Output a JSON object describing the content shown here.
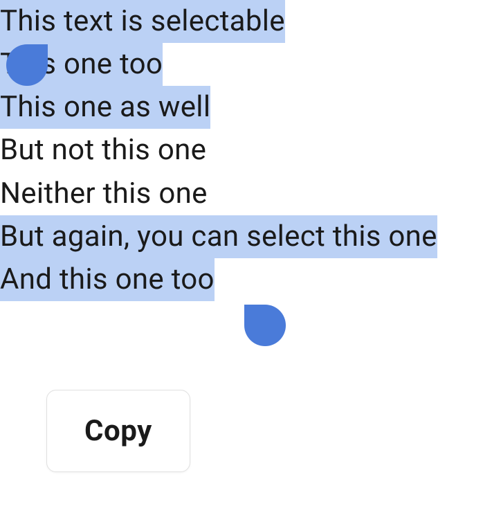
{
  "lines": [
    {
      "text": "This text is selectable",
      "highlighted": true
    },
    {
      "text": "This one too",
      "highlighted": true
    },
    {
      "text": "This one as well",
      "highlighted": true
    },
    {
      "text": "But not this one",
      "highlighted": false
    },
    {
      "text": "Neither this one",
      "highlighted": false
    },
    {
      "text": "But again, you can select this one",
      "highlighted": true
    },
    {
      "text": "And this one too",
      "highlighted": true
    }
  ],
  "contextMenu": {
    "copy_label": "Copy"
  },
  "colors": {
    "highlight": "#bbd1f5",
    "handle": "#4a7bd9"
  }
}
